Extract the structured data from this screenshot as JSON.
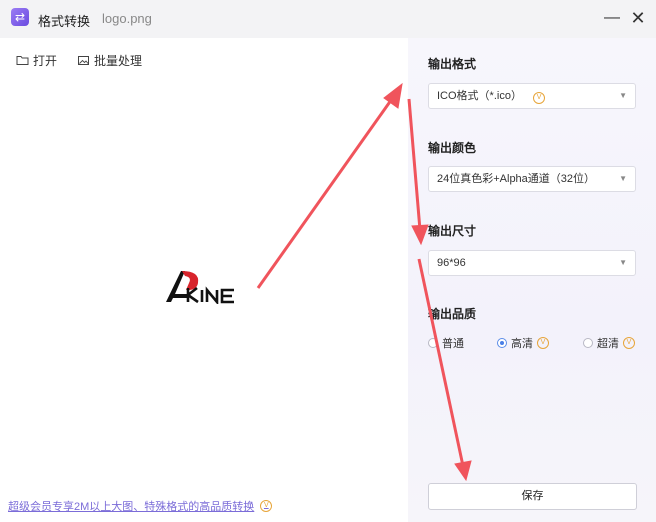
{
  "titlebar": {
    "app_icon": "⇄",
    "title": "格式转换",
    "file_name": "logo.png",
    "minimize_glyph": "—",
    "close_glyph": "✕"
  },
  "toolbar": {
    "open_label": "打开",
    "batch_label": "批量处理"
  },
  "promo": {
    "text": "超级会员专享2M以上大图、特殊格式的高品质转换"
  },
  "settings": {
    "format": {
      "label": "输出格式",
      "value": "ICO格式（*.ico）"
    },
    "color": {
      "label": "输出颜色",
      "value": "24位真色彩+Alpha通道（32位）"
    },
    "size": {
      "label": "输出尺寸",
      "value": "96*96"
    },
    "quality": {
      "label": "输出品质",
      "options": [
        "普通",
        "高清",
        "超清"
      ],
      "selected": "高清"
    }
  },
  "save_label": "保存",
  "colors": {
    "accent": "#6a4be0",
    "arrow": "#f0545c",
    "promo": "#7b6cd8"
  }
}
